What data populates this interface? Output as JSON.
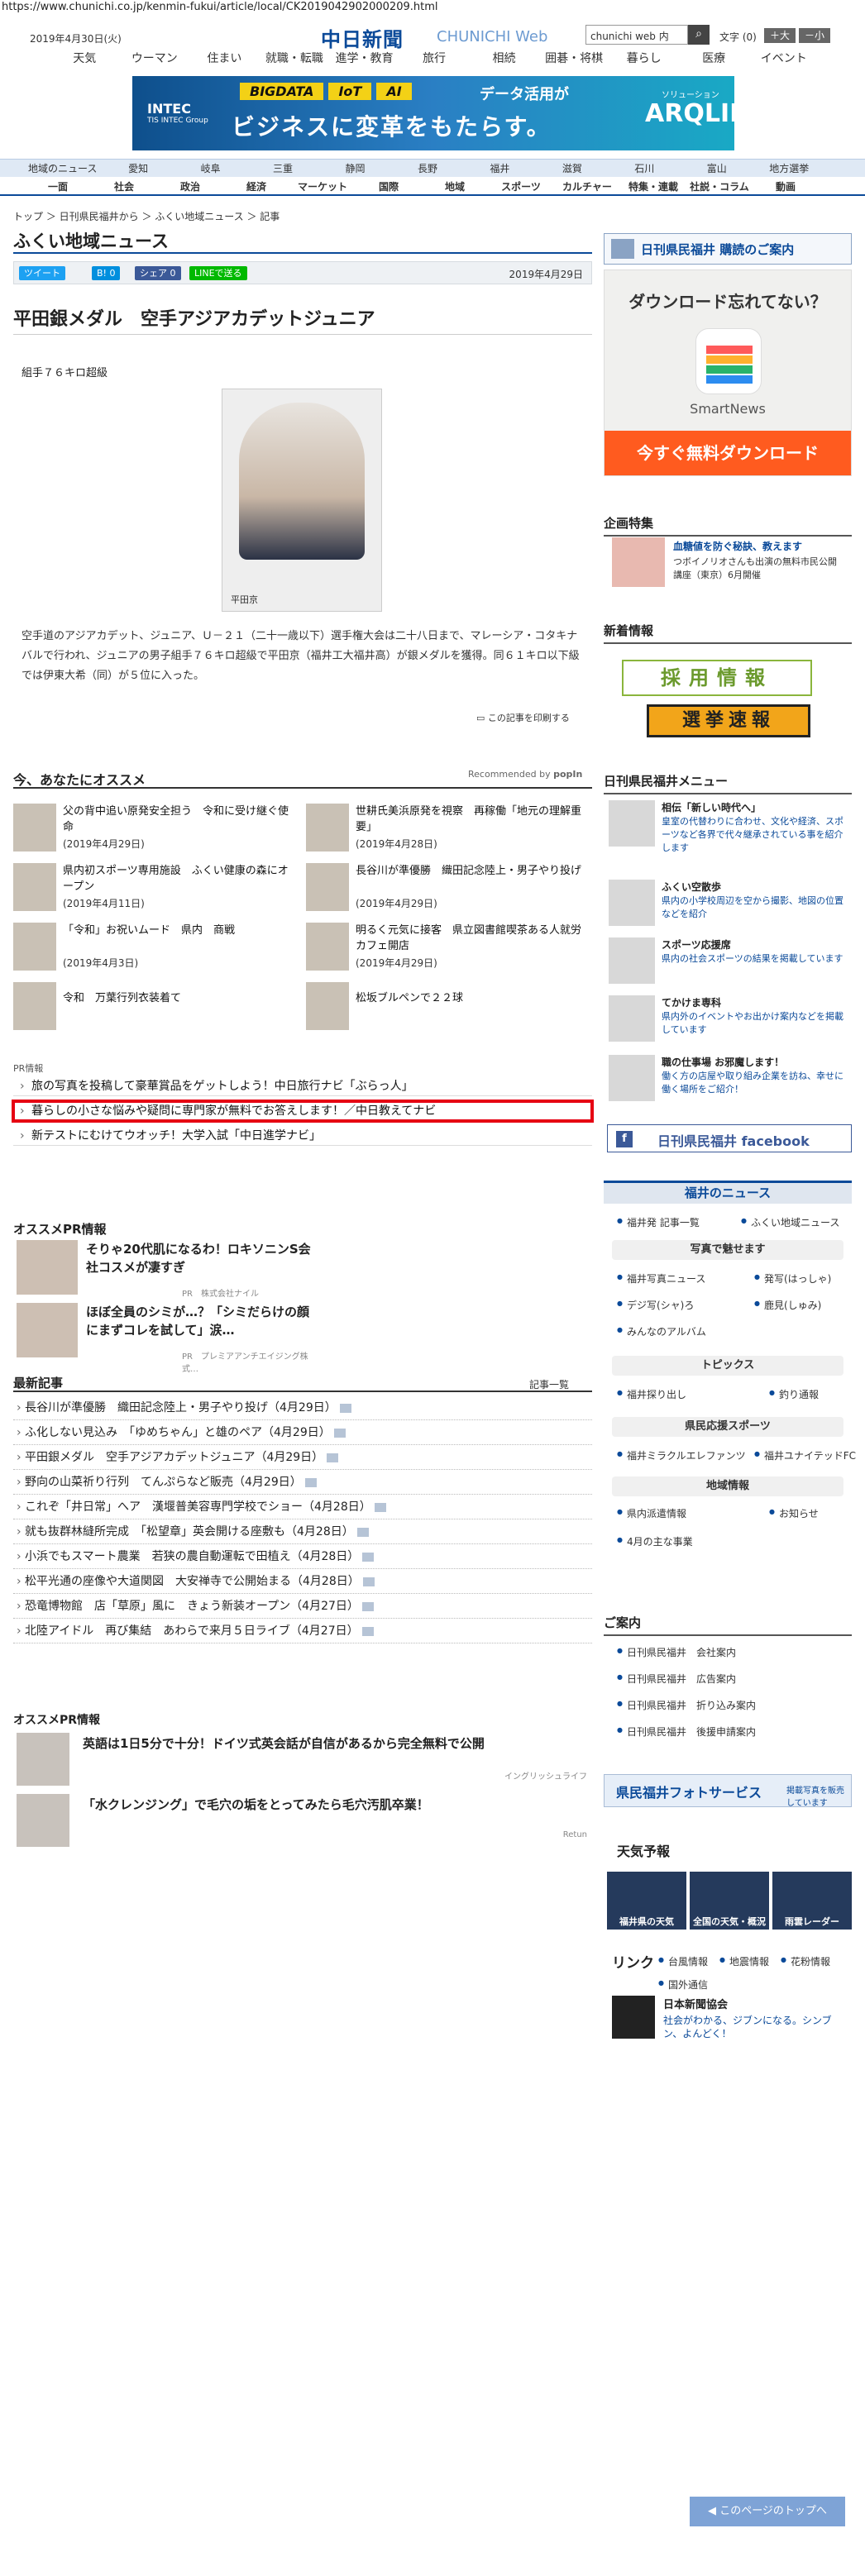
{
  "url": "https://www.chunichi.co.jp/kenmin-fukui/article/local/CK2019042902000209.html",
  "header": {
    "date": "2019年4月30日(火)",
    "logo": "中日新聞",
    "logo_sub": "CHUNICHI Web",
    "search_placeholder": "chunichi web 内",
    "search_icon": "search-icon",
    "font_size_label": "文字",
    "font_default": "(0)",
    "font_large": "＋大",
    "font_small": "－小",
    "categories": [
      "天気",
      "ウーマン",
      "住まい",
      "就職・転職",
      "進学・教育",
      "旅行",
      "相続",
      "囲碁・将棋",
      "暮らし",
      "医療",
      "イベント"
    ]
  },
  "ad_top": {
    "tags": [
      "BIGDATA",
      "IoT",
      "AI"
    ],
    "line1": "データ活用が",
    "line2": "ビジネスに変革をもたらす。",
    "company": "INTEC",
    "company_sub": "TIS INTEC Group",
    "product": "ARQLID",
    "product_sub": "ソリューション"
  },
  "nav1": [
    "地域のニュース",
    "愛知",
    "岐阜",
    "三重",
    "静岡",
    "長野",
    "福井",
    "滋賀",
    "石川",
    "富山",
    "地方選挙"
  ],
  "nav2": [
    "一面",
    "社会",
    "政治",
    "経済",
    "マーケット",
    "国際",
    "地域",
    "スポーツ",
    "カルチャー",
    "特集・連載",
    "社説・コラム",
    "動画"
  ],
  "breadcrumb": "トップ ＞ 日刊県民福井から ＞ ふくい地域ニュース ＞ 記事",
  "section_title": "ふくい地域ニュース",
  "share": {
    "tweet": "ツイート",
    "b": "B! 0",
    "fb": "シェア 0",
    "line": "LINEで送る"
  },
  "article": {
    "pubdate": "2019年4月29日",
    "title": "平田銀メダル　空手アジアカデットジュニア",
    "subhead": "組手７６キロ超級",
    "photo_caption": "平田京",
    "body": "空手道のアジアカデット、ジュニア、Ｕ－２１（二十一歳以下）選手権大会は二十八日まで、マレーシア・コタキナバルで行われ、ジュニアの男子組手７６キロ超級で平田京（福井工大福井高）が銀メダルを獲得。同６１キロ以下級では伊東大希（同）が５位に入った。",
    "print": "この記事を印刷する"
  },
  "recommend": {
    "title": "今、あなたにオススメ",
    "by": "Recommended by",
    "popin": "popIn",
    "items": [
      {
        "title": "父の背中追い原発安全担う　令和に受け継ぐ使命",
        "date": "(2019年4月29日)"
      },
      {
        "title": "世耕氏美浜原発を視察　再稼働「地元の理解重要」",
        "date": "(2019年4月28日)"
      },
      {
        "title": "県内初スポーツ専用施設　ふくい健康の森にオープン",
        "date": "(2019年4月11日)"
      },
      {
        "title": "長谷川が準優勝　織田記念陸上・男子やり投げ",
        "date": "(2019年4月29日)"
      },
      {
        "title": "「令和」お祝いムード　県内　商戦",
        "date": "(2019年4月3日)"
      },
      {
        "title": "明るく元気に接客　県立図書館喫茶ある人就労カフェ開店",
        "date": "(2019年4月29日)"
      },
      {
        "title": "令和　万葉行列衣装着て",
        "date": ""
      },
      {
        "title": "松坂ブルペンで２２球",
        "date": ""
      }
    ]
  },
  "pr": {
    "label": "PR情報",
    "rows": [
      "旅の写真を投稿して豪華賞品をゲットしよう！中日旅行ナビ「ぶらっ人」",
      "暮らしの小さな悩みや疑問に専門家が無料でお答えします！／中日教えてナビ",
      "新テストにむけてウオッチ！大学入試「中日進学ナビ」"
    ]
  },
  "osusume_pr": {
    "title": "オススメPR情報",
    "items": [
      {
        "title": "そりゃ20代肌になるわ！ロキソニンS会社コスメが凄すぎ",
        "pr": "PR　株式会社ナイル"
      },
      {
        "title": "ほぼ全員のシミが…？「シミだらけの顔にまずコレを試して」涙…",
        "pr": "PR　プレミアアンチエイジング株式…"
      }
    ]
  },
  "latest": {
    "title": "最新記事",
    "more": "記事一覧",
    "items": [
      "長谷川が準優勝　織田記念陸上・男子やり投げ（4月29日）",
      "ふ化しない見込み　「ゆめちゃん」と雄のペア（4月29日）",
      "平田銀メダル　空手アジアカデットジュニア（4月29日）",
      "野向の山菜祈り行列　てんぷらなど販売（4月29日）",
      "これぞ「井日常」へア　漢堰普美容専門学校でショー（4月28日）",
      "就も抜群林縫所完成　「松望章」英会開ける座敷も（4月28日）",
      "小浜でもスマート農業　若狭の農自動運転で田植え（4月28日）",
      "松平光通の座像や大道関図　大安禅寺で公開始まる（4月28日）",
      "恐竜博物館　店「草原」風に　きょう新装オープン（4月27日）",
      "北陸アイドル　再び集結　あわらで来月５日ライブ（4月27日）"
    ]
  },
  "osusume_pr2": {
    "title": "オススメPR情報",
    "items": [
      {
        "title": "英語は1日5分で十分！ドイツ式英会話が自信があるから完全無料で公開",
        "pr": "イングリッシュライフ"
      },
      {
        "title": "「水クレンジング」で毛穴の垢をとってみたら毛穴汚肌卒業！",
        "pr": "Retun"
      }
    ]
  },
  "side": {
    "nikkan_banner": "日刊県民福井 購読のご案内",
    "sn_ad": {
      "headline": "ダウンロード忘れてない？",
      "name": "SmartNews",
      "button": "今すぐ無料ダウンロード"
    },
    "kikaku_title": "企画特集",
    "kikaku": {
      "title": "血糖値を防ぐ秘訣、教えます",
      "desc": "つボイノリオさんも出演の無料市民公開講座（東京）6月開催"
    },
    "shinchaku_title": "新着情報",
    "saiyo": "採用情報",
    "senkyo": "選挙速報",
    "menu_title": "日刊県民福井メニュー",
    "menu": [
      {
        "title": "相伝「新しい時代へ」",
        "desc": "皇室の代替わりに合わせ、文化や経済、スポーツなど各界で代々継承されている事を紹介します"
      },
      {
        "title": "ふくい空散歩",
        "desc": "県内の小学校周辺を空から撮影、地図の位置などを紹介"
      },
      {
        "title": "スポーツ応援席",
        "desc": "県内の社会スポーツの結果を掲載しています"
      },
      {
        "title": "てかけま専科",
        "desc": "県内外のイベントやお出かけ案内などを掲載しています"
      },
      {
        "title": "職の仕事場 お邪魔します！",
        "desc": "働く方の店屋や取り組み企業を訪ね、幸せに働く場所をご紹介！"
      }
    ],
    "facebook": "日刊県民福井 facebook",
    "fukui_news_title": "福井のニュース",
    "fukui_news_links": [
      "福井発 記事一覧",
      "ふくい地域ニュース"
    ],
    "photo_title": "写真で魅せます",
    "photo_links": [
      "福井写真ニュース",
      "発写(はっしゃ)",
      "デジ写(シャ)ろ",
      "鹿見(しゅみ)",
      "みんなのアルバム"
    ],
    "topics_title": "トピックス",
    "topics_links": [
      "福井探り出し",
      "釣り通報"
    ],
    "sports_title": "県民応援スポーツ",
    "sports_links": [
      "福井ミラクルエレファンツ",
      "福井ユナイテッドFC"
    ],
    "local_title": "地域情報",
    "local_links": [
      "県内派遣情報",
      "お知らせ",
      "4月の主な事業"
    ],
    "annai_title": "ご案内",
    "annai_links": [
      "日刊県民福井　会社案内",
      "日刊県民福井　広告案内",
      "日刊県民福井　折り込み案内",
      "日刊県民福井　後援申請案内"
    ],
    "photo_service": "県民福井フォトサービス",
    "photo_service_sub": "掲載写真を販売しています",
    "weather_title": "天気予報",
    "weather": [
      "福井県の天気",
      "全国の天気・概況",
      "雨雲レーダー"
    ],
    "link_title": "リンク",
    "link_links": [
      "台風情報",
      "地震情報",
      "花粉情報",
      "国外通信"
    ],
    "nihon": {
      "title": "日本新聞協会",
      "desc": "社会がわかる、ジブンになる。シンブン、よんどく！"
    },
    "page_top": "このページのトップへ"
  }
}
